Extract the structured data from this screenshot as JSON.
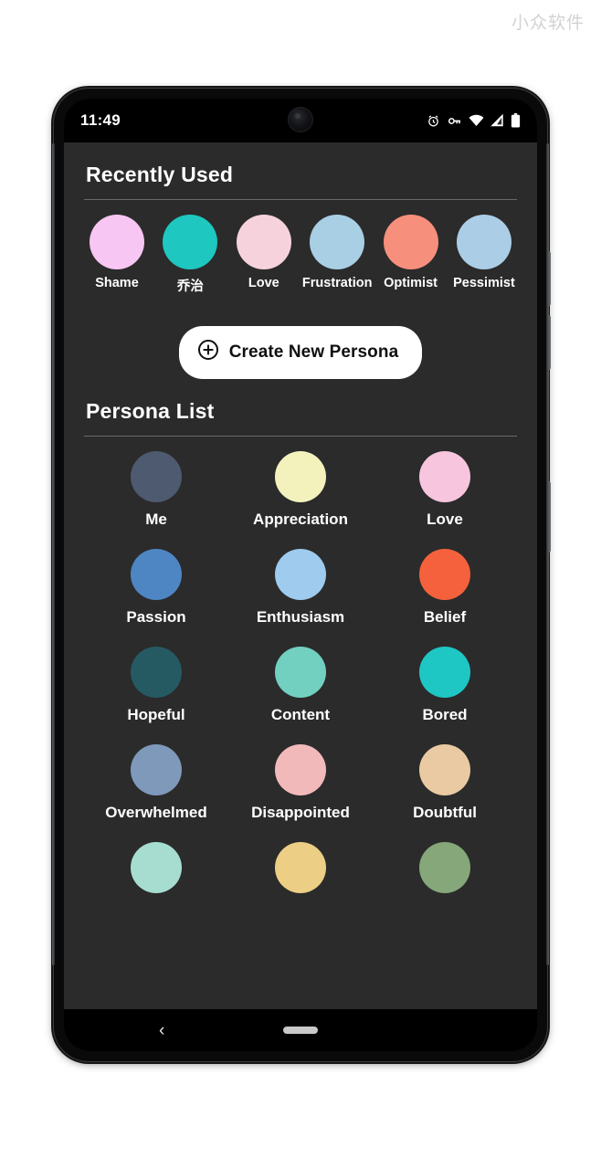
{
  "watermark": "小众软件",
  "status_bar": {
    "time": "11:49",
    "icons": [
      "alarm-icon",
      "vpn-key-icon",
      "wifi-icon",
      "signal-icon",
      "battery-icon"
    ]
  },
  "recently_used": {
    "title": "Recently Used",
    "items": [
      {
        "label": "Shame",
        "color": "#f7c6f2"
      },
      {
        "label": "乔治",
        "color": "#1ec7c0"
      },
      {
        "label": "Love",
        "color": "#f6d3dc"
      },
      {
        "label": "Frustration",
        "color": "#a8cfe4"
      },
      {
        "label": "Optimist",
        "color": "#f78f7d"
      },
      {
        "label": "Pessimist",
        "color": "#abcde6"
      }
    ]
  },
  "create_button": {
    "label": "Create New Persona",
    "icon": "plus-circle-icon"
  },
  "persona_list": {
    "title": "Persona List",
    "items": [
      {
        "label": "Me",
        "color": "#4e5a70"
      },
      {
        "label": "Appreciation",
        "color": "#f3f2bd"
      },
      {
        "label": "Love",
        "color": "#f7c5dd"
      },
      {
        "label": "Passion",
        "color": "#4e86c4"
      },
      {
        "label": "Enthusiasm",
        "color": "#9ecbee"
      },
      {
        "label": "Belief",
        "color": "#f4613c"
      },
      {
        "label": "Hopeful",
        "color": "#255a63"
      },
      {
        "label": "Content",
        "color": "#72d0c0"
      },
      {
        "label": "Bored",
        "color": "#1ec7c4"
      },
      {
        "label": "Overwhelmed",
        "color": "#7f99bb"
      },
      {
        "label": "Disappointed",
        "color": "#f2b9bb"
      },
      {
        "label": "Doubtful",
        "color": "#e9caa2"
      },
      {
        "label": "",
        "color": "#a7ddd0"
      },
      {
        "label": "",
        "color": "#ecce84"
      },
      {
        "label": "",
        "color": "#85a779"
      }
    ]
  },
  "nav_bar": {
    "back_label": "‹",
    "back_icon": "back-chevron-icon",
    "home_icon": "home-pill-icon"
  }
}
